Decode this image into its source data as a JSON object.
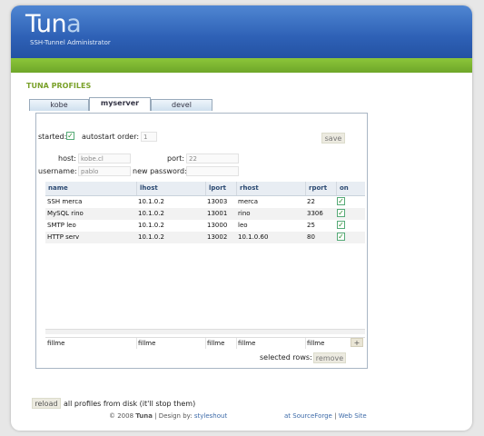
{
  "header": {
    "logo_main": "Tun",
    "logo_accent": "a",
    "tagline": "SSH-Tunnel Administrator"
  },
  "section_title": "TUNA PROFILES",
  "tabs": [
    {
      "label": "kobe",
      "active": false
    },
    {
      "label": "myserver",
      "active": true
    },
    {
      "label": "devel",
      "active": false
    }
  ],
  "profile": {
    "started_label": "started:",
    "started_checked": true,
    "autostart_label": "autostart order:",
    "autostart_value": "1",
    "save_label": "save",
    "host_label": "host:",
    "host_value": "kobe.cl",
    "port_label": "port:",
    "port_value": "22",
    "username_label": "username:",
    "username_value": "pablo",
    "password_label": "new password:",
    "password_value": ""
  },
  "table": {
    "columns": [
      "name",
      "lhost",
      "lport",
      "rhost",
      "rport",
      "on"
    ],
    "rows": [
      {
        "name": "SSH merca",
        "lhost": "10.1.0.2",
        "lport": "13003",
        "rhost": "merca",
        "rport": "22",
        "on": true
      },
      {
        "name": "MySQL rino",
        "lhost": "10.1.0.2",
        "lport": "13001",
        "rhost": "rino",
        "rport": "3306",
        "on": true
      },
      {
        "name": "SMTP leo",
        "lhost": "10.1.0.2",
        "lport": "13000",
        "rhost": "leo",
        "rport": "25",
        "on": true
      },
      {
        "name": "HTTP serv",
        "lhost": "10.1.0.2",
        "lport": "13002",
        "rhost": "10.1.0.60",
        "rport": "80",
        "on": true
      }
    ],
    "filler": [
      "fillme",
      "fillme",
      "fillme",
      "fillme",
      "fillme"
    ],
    "add_label": "+"
  },
  "selection": {
    "label": "selected rows:",
    "remove_label": "remove"
  },
  "reload": {
    "button_label": "reload",
    "text": "all profiles from disk (it'll stop them)"
  },
  "footer": {
    "copyright_prefix": "© 2008",
    "brand": "Tuna",
    "design_text": "| Design by:",
    "design_link": "styleshout",
    "sourceforge_link": "at SourceForge",
    "separator": "|",
    "website_link": "Web Site"
  },
  "colors": {
    "header_blue": "#2e61b6",
    "accent_green": "#7aa12a",
    "check_green": "#2a8a2a"
  }
}
